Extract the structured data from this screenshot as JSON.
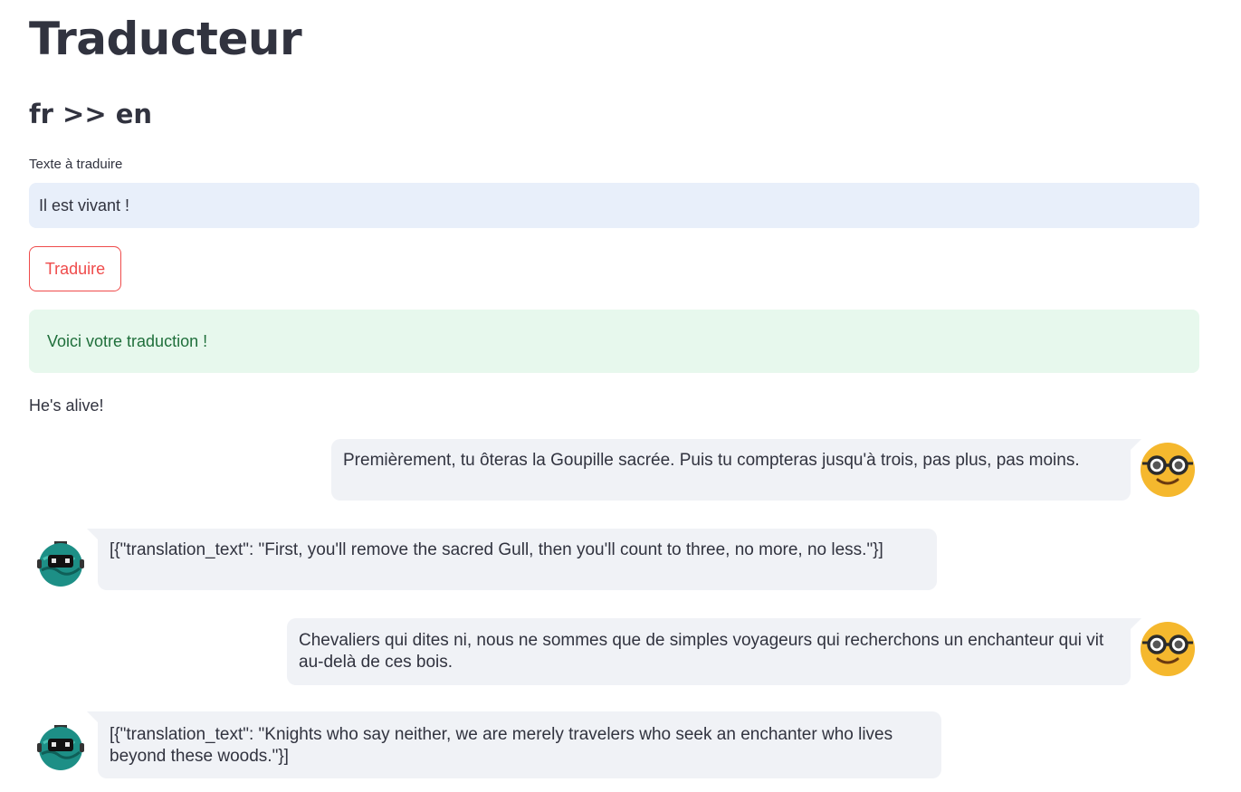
{
  "header": {
    "title": "Traducteur",
    "subtitle": "fr >> en"
  },
  "form": {
    "input_label": "Texte à traduire",
    "input_value": "Il est vivant !",
    "button_label": "Traduire"
  },
  "status": {
    "success_message": "Voici votre traduction !",
    "result_text": "He's alive!"
  },
  "chat": {
    "messages": [
      {
        "role": "user",
        "avatar_icon": "nerd-face-icon",
        "text": "Premièrement, tu ôteras la Goupille sacrée. Puis tu compteras jusqu'à trois, pas plus, pas moins."
      },
      {
        "role": "bot",
        "avatar_icon": "robot-icon",
        "text": "[{\"translation_text\": \"First, you'll remove the sacred Gull, then you'll count to three, no more, no less.\"}]"
      },
      {
        "role": "user",
        "avatar_icon": "nerd-face-icon",
        "text": "Chevaliers qui dites ni, nous ne sommes que de simples voyageurs qui recherchons un enchanteur qui vit au-delà de ces bois."
      },
      {
        "role": "bot",
        "avatar_icon": "robot-icon",
        "text": "[{\"translation_text\": \"Knights who say neither, we are merely travelers who seek an enchanter who lives beyond these woods.\"}]"
      }
    ]
  },
  "colors": {
    "primary": "#ef4b4b",
    "text": "#31333f",
    "input_bg": "#e8effa",
    "success_bg": "#e7f8ed",
    "success_text": "#1f6f3b",
    "chat_bubble_bg": "#f0f2f6",
    "user_avatar": "#f5b82e",
    "bot_avatar": "#1d8f86"
  }
}
